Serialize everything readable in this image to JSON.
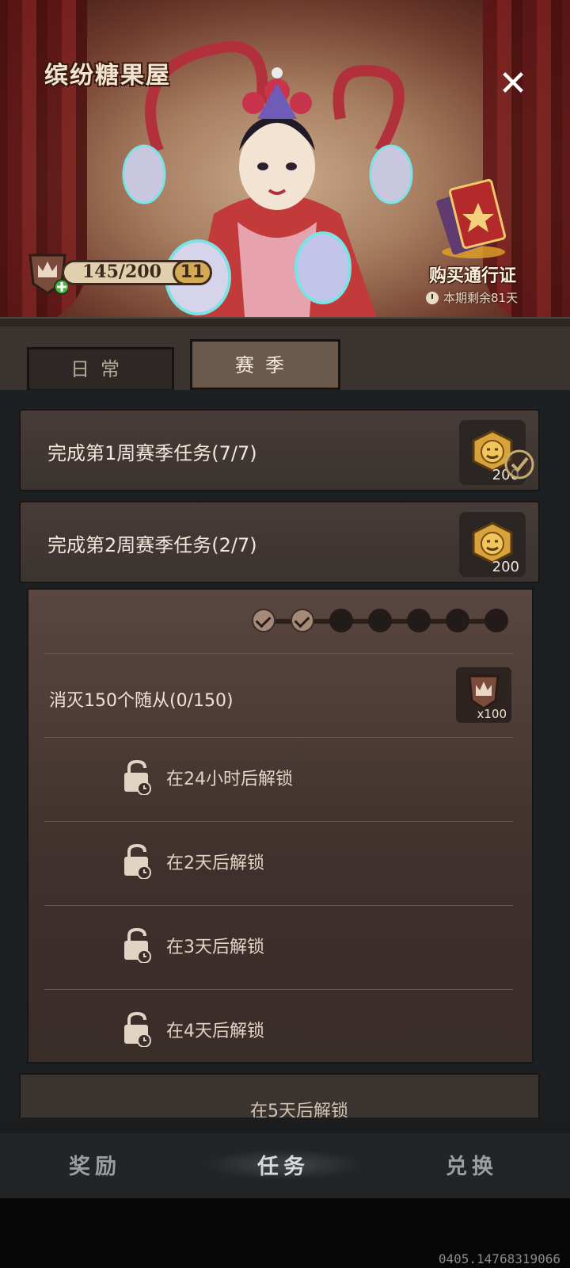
{
  "banner": {
    "title": "缤纷糖果屋",
    "close_icon": "close-icon",
    "xp_text": "145/200",
    "level": "11",
    "pass_button": "购买通行证",
    "pass_timer": "本期剩余81天"
  },
  "tabs": [
    {
      "label": "日常",
      "active": false
    },
    {
      "label": "赛季",
      "active": true
    }
  ],
  "tasks": [
    {
      "title": "完成第1周赛季任务(7/7)",
      "reward": "200",
      "claimed": true
    },
    {
      "title": "完成第2周赛季任务(2/7)",
      "reward": "200",
      "claimed": false
    }
  ],
  "expanded": {
    "progress_done": 2,
    "progress_total": 7,
    "subtask": {
      "title": "消灭150个随从(0/150)",
      "reward": "x100"
    },
    "locked": [
      "在24小时后解锁",
      "在2天后解锁",
      "在3天后解锁",
      "在4天后解锁"
    ]
  },
  "next_card_text": "在5天后解锁",
  "bottom_nav": [
    {
      "label": "奖励",
      "active": false
    },
    {
      "label": "任务",
      "active": true
    },
    {
      "label": "兑换",
      "active": false
    }
  ],
  "build_id": "0405.14768319066",
  "colors": {
    "accent_gold": "#d4aa55",
    "panel": "#3b3330"
  }
}
